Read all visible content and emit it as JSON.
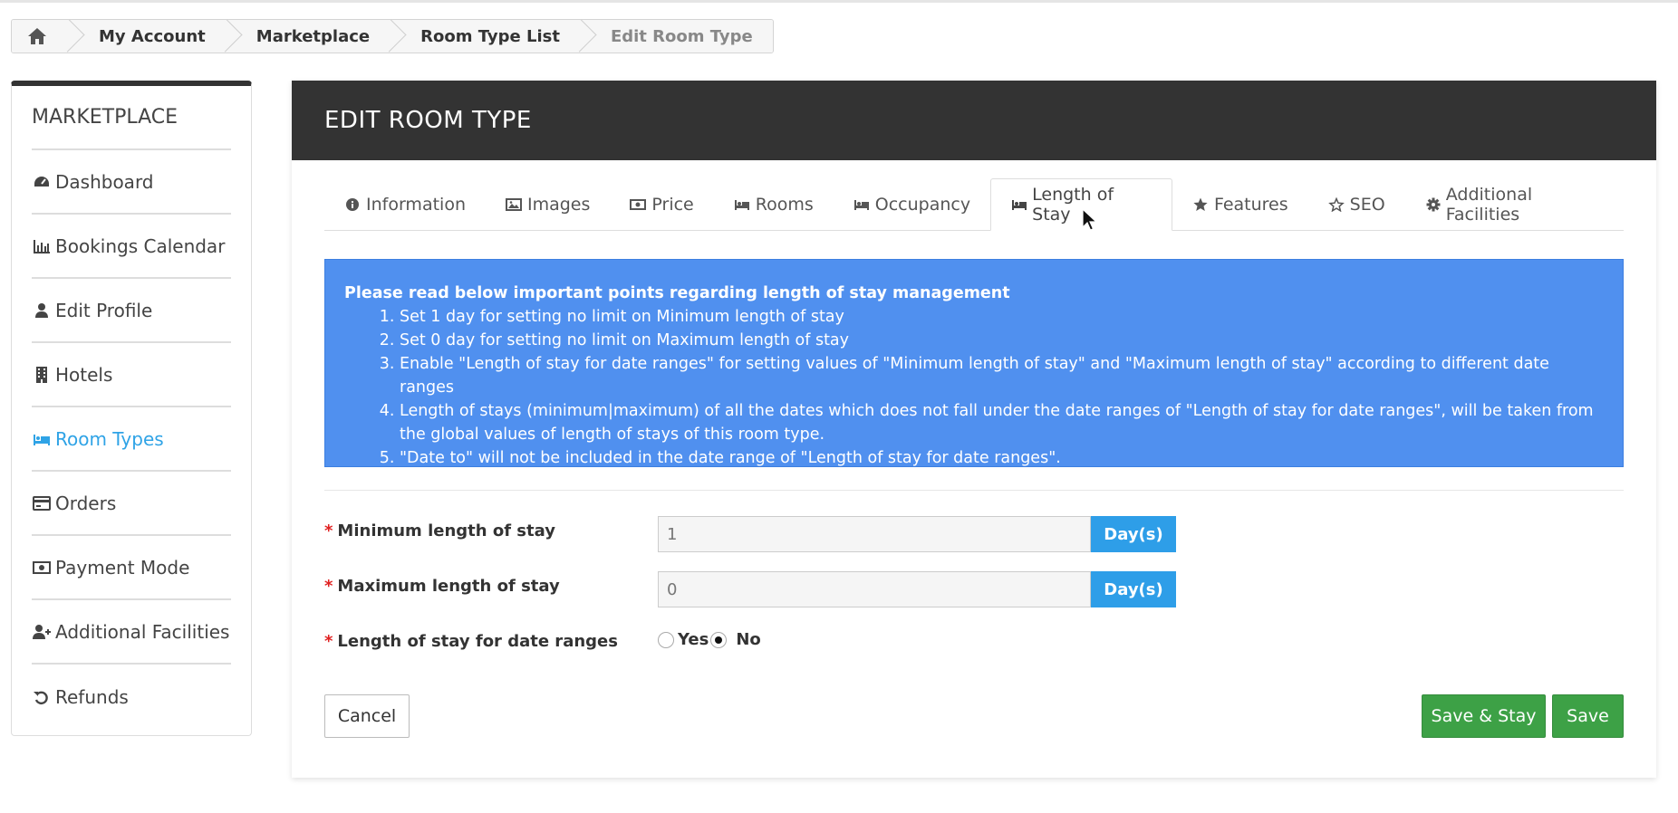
{
  "breadcrumb": {
    "items": [
      "My Account",
      "Marketplace",
      "Room Type List"
    ],
    "current": "Edit Room Type"
  },
  "sidebar": {
    "title": "MARKETPLACE",
    "items": [
      {
        "label": "Dashboard",
        "icon": "dashboard-icon"
      },
      {
        "label": "Bookings Calendar",
        "icon": "bar-chart-icon"
      },
      {
        "label": "Edit Profile",
        "icon": "user-icon"
      },
      {
        "label": "Hotels",
        "icon": "building-icon"
      },
      {
        "label": "Room Types",
        "icon": "bed-icon",
        "active": true
      },
      {
        "label": "Orders",
        "icon": "credit-card-icon"
      },
      {
        "label": "Payment Mode",
        "icon": "money-icon"
      },
      {
        "label": "Additional Facilities",
        "icon": "user-plus-icon"
      },
      {
        "label": "Refunds",
        "icon": "undo-icon"
      }
    ],
    "active_color": "#2fa3e6"
  },
  "panel": {
    "title": "EDIT ROOM TYPE",
    "tabs": [
      {
        "label": "Information",
        "icon": "info-circle-icon"
      },
      {
        "label": "Images",
        "icon": "image-icon"
      },
      {
        "label": "Price",
        "icon": "money-icon"
      },
      {
        "label": "Rooms",
        "icon": "bed-icon"
      },
      {
        "label": "Occupancy",
        "icon": "bed-icon"
      },
      {
        "label": "Length of Stay",
        "icon": "bed-icon",
        "active": true
      },
      {
        "label": "Features",
        "icon": "star-icon"
      },
      {
        "label": "SEO",
        "icon": "star-outline-icon"
      },
      {
        "label": "Additional Facilities",
        "icon": "gear-icon"
      }
    ]
  },
  "info": {
    "title": "Please read below important points regarding length of stay management",
    "points": [
      "Set 1 day for setting no limit on Minimum length of stay",
      "Set 0 day for setting no limit on Maximum length of stay",
      "Enable \"Length of stay for date ranges\" for setting values of \"Minimum length of stay\" and \"Maximum length of stay\" according to different date ranges",
      "Length of stays (minimum|maximum) of all the dates which does not fall under the date ranges of \"Length of stay for date ranges\", will be taken from the global values of length of stays of this room type.",
      "\"Date to\" will not be included in the date range of \"Length of stay for date ranges\"."
    ],
    "background_color": "#5090ef"
  },
  "form": {
    "min_stay": {
      "label": "Minimum length of stay",
      "value": "1",
      "addon": "Day(s)"
    },
    "max_stay": {
      "label": "Maximum length of stay",
      "value": "0",
      "addon": "Day(s)"
    },
    "date_ranges": {
      "label": "Length of stay for date ranges",
      "yes": "Yes",
      "no": "No",
      "selected": "No"
    }
  },
  "buttons": {
    "cancel": "Cancel",
    "save_stay": "Save & Stay",
    "save": "Save",
    "save_color": "#3da146"
  }
}
